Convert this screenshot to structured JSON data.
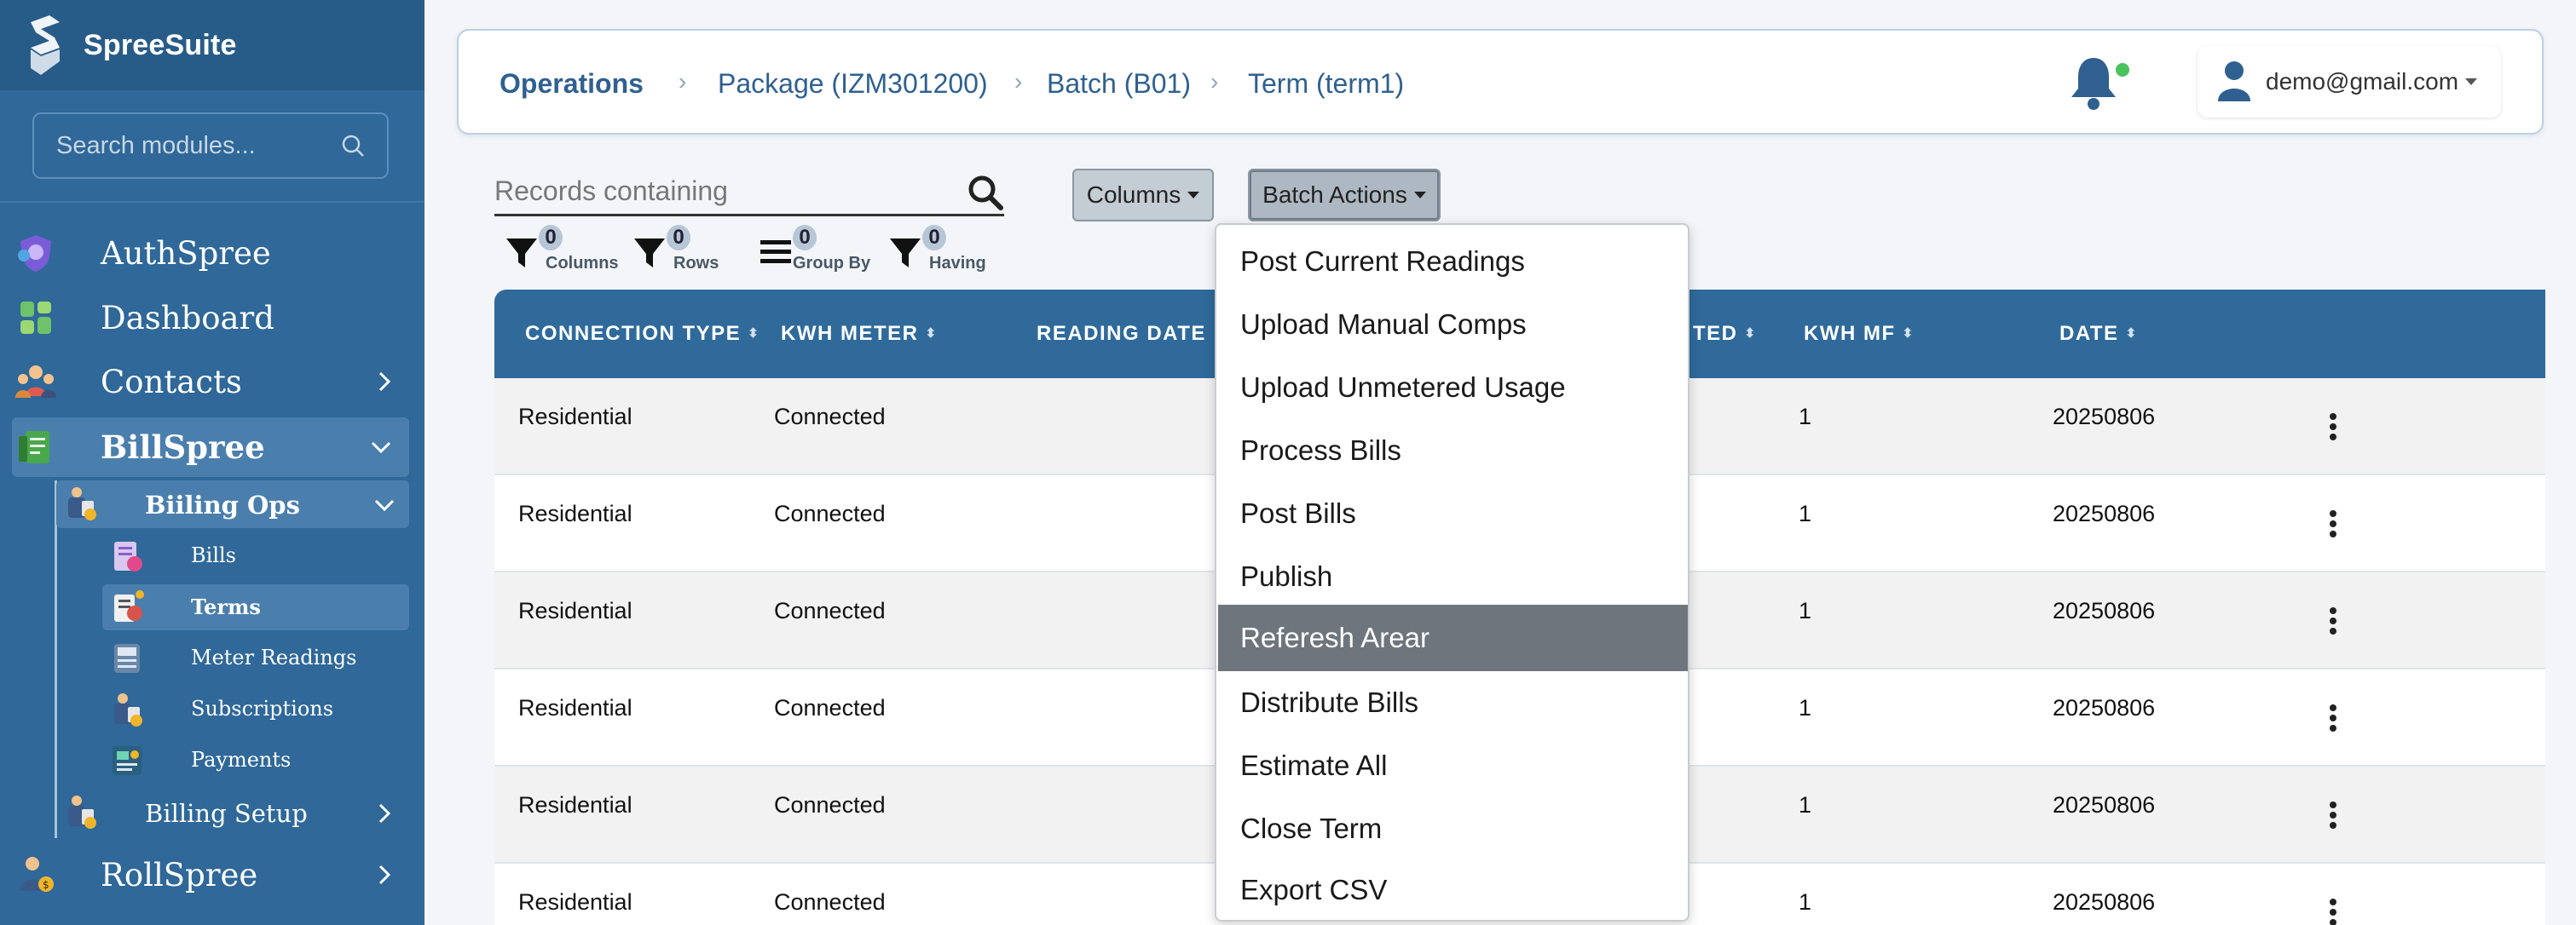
{
  "app": {
    "name": "SpreeSuite",
    "colors": {
      "sidebar": "#2f6899",
      "sidebar_dark": "#285c88",
      "table_header": "#2f6a9b",
      "notification_dot": "#49c35b",
      "menu_highlight": "#6e757d"
    }
  },
  "sidebar": {
    "search_placeholder": "Search modules...",
    "items": [
      {
        "label": "AuthSpree",
        "icon": "shield-icon"
      },
      {
        "label": "Dashboard",
        "icon": "dashboard-icon"
      },
      {
        "label": "Contacts",
        "icon": "people-icon",
        "chevron": "right"
      },
      {
        "label": "BillSpree",
        "icon": "bill-icon",
        "chevron": "down",
        "active": true
      },
      {
        "label": "RollSpree",
        "icon": "roll-icon",
        "chevron": "right"
      }
    ],
    "billspree_children": [
      {
        "label": "Biiling Ops",
        "icon": "billing-ops-icon",
        "chevron": "down",
        "active": true
      },
      {
        "label": "Billing Setup",
        "icon": "billing-setup-icon",
        "chevron": "right"
      }
    ],
    "billing_ops_children": [
      {
        "label": "Bills",
        "icon": "bills-icon"
      },
      {
        "label": "Terms",
        "icon": "terms-icon",
        "active": true
      },
      {
        "label": "Meter Readings",
        "icon": "meter-icon"
      },
      {
        "label": "Subscriptions",
        "icon": "subscriptions-icon"
      },
      {
        "label": "Payments",
        "icon": "payments-icon"
      }
    ]
  },
  "header": {
    "breadcrumb": [
      "Operations",
      "Package (IZM301200)",
      "Batch (B01)",
      "Term (term1)"
    ],
    "user_email": "demo@gmail.com"
  },
  "toolbar": {
    "search_placeholder": "Records containing",
    "columns_button": "Columns",
    "batch_actions_button": "Batch Actions",
    "filters": [
      {
        "label": "Columns",
        "count": "0",
        "icon": "funnel-icon"
      },
      {
        "label": "Rows",
        "count": "0",
        "icon": "funnel-icon"
      },
      {
        "label": "Group By",
        "count": "0",
        "icon": "list-icon"
      },
      {
        "label": "Having",
        "count": "0",
        "icon": "funnel-icon"
      }
    ]
  },
  "table": {
    "columns": [
      "CONNECTION TYPE",
      "KWH METER",
      "READING DATE",
      "TED",
      "KWH MF",
      "DATE"
    ],
    "rows": [
      [
        "Residential",
        "Connected",
        "1",
        "20250806"
      ],
      [
        "Residential",
        "Connected",
        "1",
        "20250806"
      ],
      [
        "Residential",
        "Connected",
        "1",
        "20250806"
      ],
      [
        "Residential",
        "Connected",
        "1",
        "20250806"
      ],
      [
        "Residential",
        "Connected",
        "1",
        "20250806"
      ],
      [
        "Residential",
        "Connected",
        "1",
        "20250806"
      ]
    ]
  },
  "batch_actions_menu": {
    "items": [
      "Post Current Readings",
      "Upload Manual Comps",
      "Upload Unmetered Usage",
      "Process Bills",
      "Post Bills",
      "Publish",
      "Referesh Arear",
      "Distribute Bills",
      "Estimate All",
      "Close Term",
      "Export CSV"
    ],
    "highlighted": "Referesh Arear"
  }
}
